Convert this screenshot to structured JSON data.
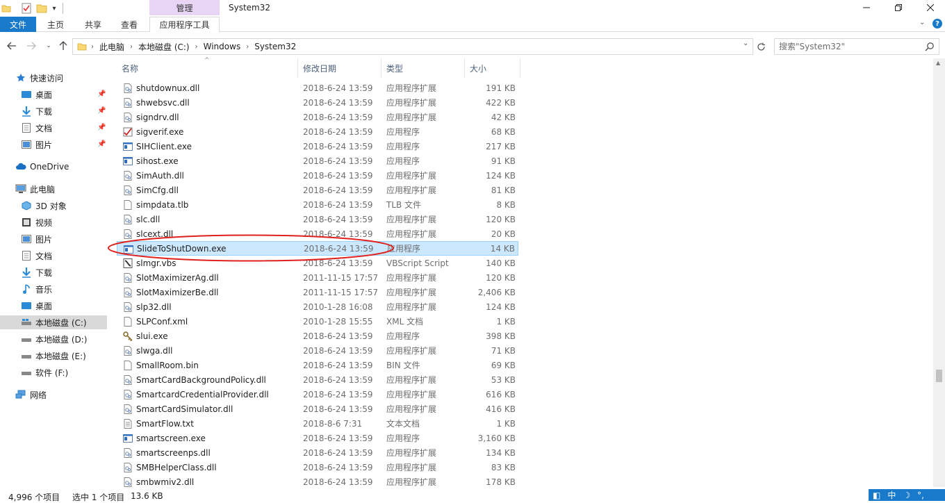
{
  "window": {
    "title": "System32",
    "manage_tab": "管理"
  },
  "ribbon": {
    "tabs": [
      "文件",
      "主页",
      "共享",
      "查看",
      "应用程序工具"
    ]
  },
  "address": {
    "crumbs": [
      "此电脑",
      "本地磁盘 (C:)",
      "Windows",
      "System32"
    ],
    "search_placeholder": "搜索\"System32\""
  },
  "nav": {
    "quick_access": "快速访问",
    "quick_items": [
      "桌面",
      "下载",
      "文档",
      "图片"
    ],
    "onedrive": "OneDrive",
    "this_pc": "此电脑",
    "pc_items": [
      "3D 对象",
      "视频",
      "图片",
      "文档",
      "下载",
      "音乐",
      "桌面",
      "本地磁盘 (C:)",
      "本地磁盘 (D:)",
      "本地磁盘 (E:)",
      "软件 (F:)"
    ],
    "network": "网络"
  },
  "columns": {
    "name": "名称",
    "date": "修改日期",
    "type": "类型",
    "size": "大小"
  },
  "files": [
    {
      "name": "shutdownux.dll",
      "date": "2018-6-24 13:59",
      "type": "应用程序扩展",
      "size": "191 KB",
      "icon": "dll-icon"
    },
    {
      "name": "shwebsvc.dll",
      "date": "2018-6-24 13:59",
      "type": "应用程序扩展",
      "size": "422 KB",
      "icon": "dll-icon"
    },
    {
      "name": "signdrv.dll",
      "date": "2018-6-24 13:59",
      "type": "应用程序扩展",
      "size": "42 KB",
      "icon": "dll-icon"
    },
    {
      "name": "sigverif.exe",
      "date": "2018-6-24 13:59",
      "type": "应用程序",
      "size": "68 KB",
      "icon": "sigverif-icon"
    },
    {
      "name": "SIHClient.exe",
      "date": "2018-6-24 13:59",
      "type": "应用程序",
      "size": "217 KB",
      "icon": "exe-icon"
    },
    {
      "name": "sihost.exe",
      "date": "2018-6-24 13:59",
      "type": "应用程序",
      "size": "91 KB",
      "icon": "exe-icon"
    },
    {
      "name": "SimAuth.dll",
      "date": "2018-6-24 13:59",
      "type": "应用程序扩展",
      "size": "124 KB",
      "icon": "dll-icon"
    },
    {
      "name": "SimCfg.dll",
      "date": "2018-6-24 13:59",
      "type": "应用程序扩展",
      "size": "81 KB",
      "icon": "dll-icon"
    },
    {
      "name": "simpdata.tlb",
      "date": "2018-6-24 13:59",
      "type": "TLB 文件",
      "size": "8 KB",
      "icon": "file-icon"
    },
    {
      "name": "slc.dll",
      "date": "2018-6-24 13:59",
      "type": "应用程序扩展",
      "size": "120 KB",
      "icon": "dll-icon"
    },
    {
      "name": "slcext.dll",
      "date": "2018-6-24 13:59",
      "type": "应用程序扩展",
      "size": "20 KB",
      "icon": "dll-icon"
    },
    {
      "name": "SlideToShutDown.exe",
      "date": "2018-6-24 13:59",
      "type": "应用程序",
      "size": "14 KB",
      "icon": "exe-icon",
      "selected": true
    },
    {
      "name": "slmgr.vbs",
      "date": "2018-6-24 13:59",
      "type": "VBScript Script",
      "size": "140 KB",
      "icon": "script-icon"
    },
    {
      "name": "SlotMaximizerAg.dll",
      "date": "2011-11-15 17:57",
      "type": "应用程序扩展",
      "size": "120 KB",
      "icon": "dll-icon"
    },
    {
      "name": "SlotMaximizerBe.dll",
      "date": "2011-11-15 17:57",
      "type": "应用程序扩展",
      "size": "2,406 KB",
      "icon": "dll-icon"
    },
    {
      "name": "slp32.dll",
      "date": "2010-1-28 16:08",
      "type": "应用程序扩展",
      "size": "124 KB",
      "icon": "dll-icon"
    },
    {
      "name": "SLPConf.xml",
      "date": "2010-1-28 15:55",
      "type": "XML 文档",
      "size": "1 KB",
      "icon": "file-icon"
    },
    {
      "name": "slui.exe",
      "date": "2018-6-24 13:59",
      "type": "应用程序",
      "size": "398 KB",
      "icon": "key-icon"
    },
    {
      "name": "slwga.dll",
      "date": "2018-6-24 13:59",
      "type": "应用程序扩展",
      "size": "71 KB",
      "icon": "dll-icon"
    },
    {
      "name": "SmallRoom.bin",
      "date": "2018-6-24 13:59",
      "type": "BIN 文件",
      "size": "69 KB",
      "icon": "file-icon"
    },
    {
      "name": "SmartCardBackgroundPolicy.dll",
      "date": "2018-6-24 13:59",
      "type": "应用程序扩展",
      "size": "53 KB",
      "icon": "dll-icon"
    },
    {
      "name": "SmartcardCredentialProvider.dll",
      "date": "2018-6-24 13:59",
      "type": "应用程序扩展",
      "size": "616 KB",
      "icon": "dll-icon"
    },
    {
      "name": "SmartCardSimulator.dll",
      "date": "2018-6-24 13:59",
      "type": "应用程序扩展",
      "size": "416 KB",
      "icon": "dll-icon"
    },
    {
      "name": "SmartFlow.txt",
      "date": "2018-8-6 7:31",
      "type": "文本文档",
      "size": "1 KB",
      "icon": "text-icon"
    },
    {
      "name": "smartscreen.exe",
      "date": "2018-6-24 13:59",
      "type": "应用程序",
      "size": "3,160 KB",
      "icon": "exe-icon"
    },
    {
      "name": "smartscreenps.dll",
      "date": "2018-6-24 13:59",
      "type": "应用程序扩展",
      "size": "134 KB",
      "icon": "dll-icon"
    },
    {
      "name": "SMBHelperClass.dll",
      "date": "2018-6-24 13:59",
      "type": "应用程序扩展",
      "size": "83 KB",
      "icon": "dll-icon"
    },
    {
      "name": "smbwmiv2.dll",
      "date": "2018-6-24 13:59",
      "type": "应用程序扩展",
      "size": "178 KB",
      "icon": "dll-icon"
    }
  ],
  "status": {
    "count": "4,996 个项目",
    "selected": "选中 1 个项目",
    "size": "13.6 KB"
  },
  "ime": {
    "label": "中"
  },
  "colors": {
    "accent": "#1979ca",
    "selection": "#cce8ff",
    "manage": "#e8d5f5",
    "highlight": "#e0201b"
  }
}
